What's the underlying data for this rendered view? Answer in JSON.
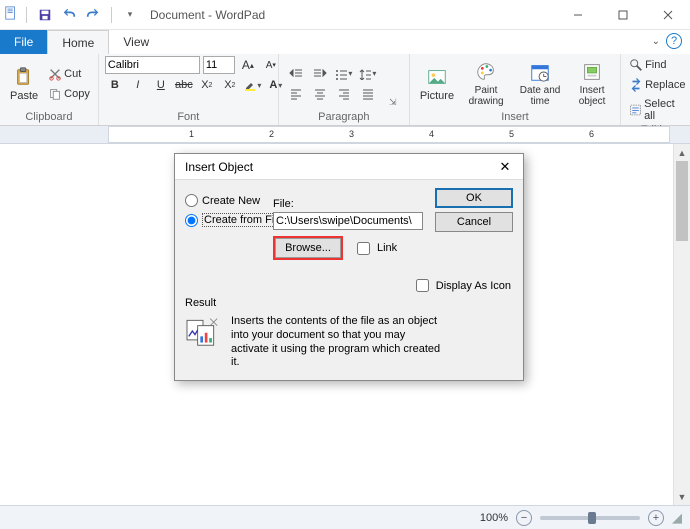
{
  "title": "Document - WordPad",
  "tabs": {
    "file": "File",
    "home": "Home",
    "view": "View"
  },
  "clipboard": {
    "paste": "Paste",
    "cut": "Cut",
    "copy": "Copy",
    "label": "Clipboard"
  },
  "font": {
    "name": "Calibri",
    "size": "11",
    "label": "Font"
  },
  "paragraph": {
    "label": "Paragraph"
  },
  "insert": {
    "picture": "Picture",
    "paint": "Paint drawing",
    "datetime": "Date and time",
    "object": "Insert object",
    "label": "Insert"
  },
  "editing": {
    "find": "Find",
    "replace": "Replace",
    "selectall": "Select all",
    "label": "Editing"
  },
  "ruler_numbers": [
    "1",
    "2",
    "3",
    "4",
    "5",
    "6"
  ],
  "status": {
    "zoom": "100%"
  },
  "dialog": {
    "title": "Insert Object",
    "create_new": "Create New",
    "create_from_file": "Create from File",
    "file_label": "File:",
    "file_value": "C:\\Users\\swipe\\Documents\\",
    "browse": "Browse...",
    "link": "Link",
    "ok": "OK",
    "cancel": "Cancel",
    "display_as_icon": "Display As Icon",
    "result_label": "Result",
    "result_text": "Inserts the contents of the file as an object into your document so that you may activate it using the program which created it."
  }
}
